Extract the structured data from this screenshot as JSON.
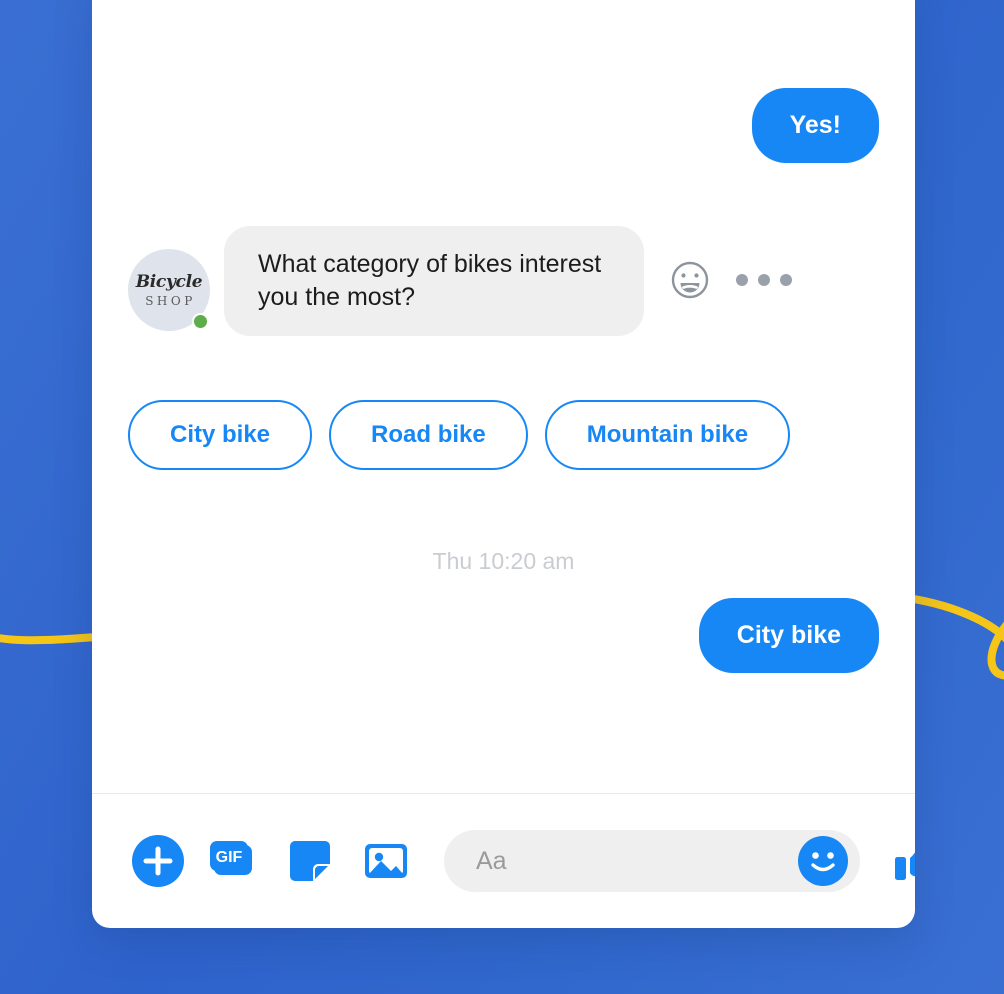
{
  "theme": {
    "background_start": "#3a6fd2",
    "background_end": "#2f63cc",
    "accent_blue": "#1787f5",
    "squiggle_yellow": "#f5c518",
    "received_bubble": "#efefef",
    "online_green": "#5dae4b",
    "timestamp_gray": "#c9ccd1"
  },
  "chat": {
    "messages": [
      {
        "id": "msg-yes",
        "direction": "outgoing",
        "text": "Yes!"
      },
      {
        "id": "msg-category",
        "direction": "incoming",
        "text": "What category of bikes interest you the most?",
        "sender": {
          "avatar_line1": "Bicycle",
          "avatar_line2": "SHOP",
          "online": true
        }
      },
      {
        "id": "msg-city-bike",
        "direction": "outgoing",
        "text": "City bike"
      }
    ],
    "quick_replies": [
      {
        "id": "qr-city",
        "label": "City bike"
      },
      {
        "id": "qr-road",
        "label": "Road bike"
      },
      {
        "id": "qr-mountain",
        "label": "Mountain bike"
      }
    ],
    "timestamp": "Thu 10:20 am",
    "message_actions": {
      "react_icon": "smiley-react-icon",
      "more_icon": "more-options-icon"
    }
  },
  "composer": {
    "tools": [
      {
        "id": "tool-plus",
        "icon": "plus-circle-icon",
        "label": ""
      },
      {
        "id": "tool-gif",
        "icon": "gif-icon",
        "label": "GIF"
      },
      {
        "id": "tool-sticker",
        "icon": "sticker-icon",
        "label": ""
      },
      {
        "id": "tool-photo",
        "icon": "photo-icon",
        "label": ""
      }
    ],
    "input": {
      "placeholder": "Aa",
      "value": ""
    },
    "emoji_icon": "emoji-smiley-icon",
    "like_icon": "thumbs-up-icon"
  }
}
